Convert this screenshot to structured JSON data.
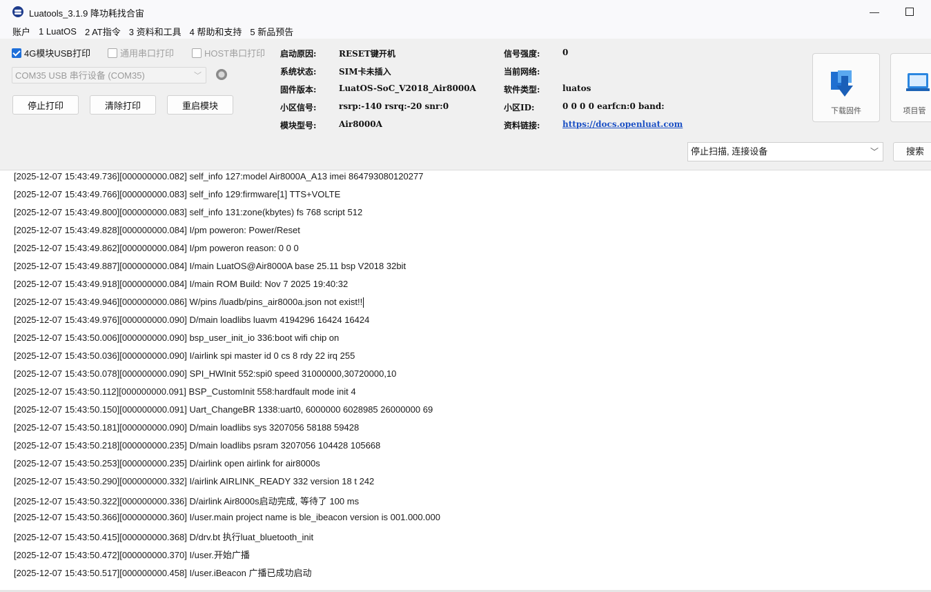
{
  "window": {
    "title": "Luatools_3.1.9 降功耗找合宙",
    "minimize_glyph": "—"
  },
  "menu": {
    "items": [
      "账户",
      "1 LuatOS",
      "2 AT指令",
      "3 资料和工具",
      "4 帮助和支持",
      "5 新品预告"
    ]
  },
  "options": {
    "usb_print": {
      "label": "4G模块USB打印",
      "checked": true
    },
    "serial_print": {
      "label": "通用串口打印",
      "checked": false
    },
    "host_print": {
      "label": "HOST串口打印",
      "checked": false
    }
  },
  "port": {
    "selected": "COM35 USB 串行设备 (COM35)"
  },
  "buttons": {
    "stop_print": "停止打印",
    "clear_print": "清除打印",
    "restart_module": "重启模块",
    "download_firmware": "下载固件",
    "project_manage": "项目管",
    "search": "搜索"
  },
  "status": {
    "boot_reason_label": "启动原因:",
    "boot_reason_value": "RESET键开机",
    "system_state_label": "系统状态:",
    "system_state_value": "SIM卡未插入",
    "firmware_label": "固件版本:",
    "firmware_value": "LuatOS-SoC_V2018_Air8000A",
    "cell_signal_label": "小区信号:",
    "cell_signal_value": "rsrp:-140 rsrq:-20 snr:0",
    "module_model_label": "模块型号:",
    "module_model_value": "Air8000A",
    "signal_strength_label": "信号强度:",
    "signal_strength_value": "0",
    "current_network_label": "当前网络:",
    "current_network_value": "",
    "software_type_label": "软件类型:",
    "software_type_value": "luatos",
    "cell_id_label": "小区ID:",
    "cell_id_value": "0 0 0 0 earfcn:0 band:",
    "docs_link_label": "资料链接:",
    "docs_link_value": "https://docs.openluat.com"
  },
  "scan": {
    "selected": "停止扫描, 连接设备"
  },
  "log": [
    "[2025-12-07 15:43:49.736][000000000.082] self_info 127:model Air8000A_A13 imei 864793080120277",
    "[2025-12-07 15:43:49.766][000000000.083] self_info 129:firmware[1] TTS+VOLTE",
    "[2025-12-07 15:43:49.800][000000000.083] self_info 131:zone(kbytes) fs 768 script 512",
    "[2025-12-07 15:43:49.828][000000000.084] I/pm poweron: Power/Reset",
    "[2025-12-07 15:43:49.862][000000000.084] I/pm poweron reason: 0 0 0",
    "[2025-12-07 15:43:49.887][000000000.084] I/main LuatOS@Air8000A base 25.11 bsp V2018 32bit",
    "[2025-12-07 15:43:49.918][000000000.084] I/main ROM Build: Nov  7 2025 19:40:32",
    "[2025-12-07 15:43:49.946][000000000.086] W/pins /luadb/pins_air8000a.json not exist!!",
    "[2025-12-07 15:43:49.976][000000000.090] D/main loadlibs luavm 4194296 16424 16424",
    "[2025-12-07 15:43:50.006][000000000.090] bsp_user_init_io 336:boot wifi chip on",
    "[2025-12-07 15:43:50.036][000000000.090] I/airlink spi master id 0 cs 8 rdy 22 irq 255",
    "[2025-12-07 15:43:50.078][000000000.090] SPI_HWInit 552:spi0 speed 31000000,30720000,10",
    "[2025-12-07 15:43:50.112][000000000.091] BSP_CustomInit 558:hardfault mode init 4",
    "[2025-12-07 15:43:50.150][000000000.091] Uart_ChangeBR 1338:uart0, 6000000 6028985 26000000 69",
    "[2025-12-07 15:43:50.181][000000000.090] D/main loadlibs sys   3207056 58188 59428",
    "[2025-12-07 15:43:50.218][000000000.235] D/main loadlibs psram 3207056 104428 105668",
    "[2025-12-07 15:43:50.253][000000000.235] D/airlink open airlink for air8000s",
    "[2025-12-07 15:43:50.290][000000000.332] I/airlink AIRLINK_READY 332 version 18 t 242",
    "[2025-12-07 15:43:50.322][000000000.336] D/airlink Air8000s启动完成, 等待了 100 ms",
    "[2025-12-07 15:43:50.366][000000000.360] I/user.main project name is  ble_ibeacon version is  001.000.000",
    "[2025-12-07 15:43:50.415][000000000.368] D/drv.bt 执行luat_bluetooth_init",
    "[2025-12-07 15:43:50.472][000000000.370] I/user.开始广播",
    "[2025-12-07 15:43:50.517][000000000.458] I/user.iBeacon 广播已成功启动"
  ]
}
